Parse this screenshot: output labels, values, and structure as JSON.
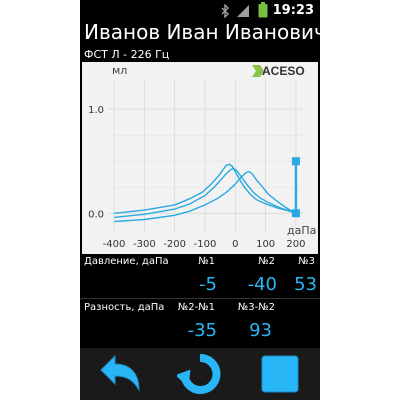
{
  "status_bar": {
    "time": "19:23",
    "icons": [
      "bluetooth-icon",
      "signal-icon",
      "battery-icon"
    ],
    "battery_color": "#76c043"
  },
  "header": {
    "patient_name": "Иванов Иван Иванович",
    "test_info": "ФСТ Л - 226 Гц",
    "brand_logo": "ACESO"
  },
  "chart_data": {
    "type": "line",
    "ylabel": "мл",
    "xlabel": "даПа",
    "x_ticks": [
      -400,
      -300,
      -200,
      -100,
      0,
      100,
      200
    ],
    "y_ticks": [
      "0.0",
      "1.0"
    ],
    "xlim": [
      -420,
      220
    ],
    "ylim": [
      -0.18,
      1.28
    ],
    "grid": true,
    "series": [
      {
        "x": [
          -400,
          -300,
          -200,
          -150,
          -110,
          -80,
          -55,
          -40,
          -30,
          -20,
          -10,
          0,
          15,
          30,
          50,
          70,
          100,
          140,
          180,
          200
        ],
        "y": [
          0.0,
          0.03,
          0.08,
          0.14,
          0.2,
          0.28,
          0.36,
          0.42,
          0.46,
          0.47,
          0.45,
          0.4,
          0.32,
          0.25,
          0.18,
          0.13,
          0.09,
          0.05,
          0.02,
          0.0
        ]
      },
      {
        "x": [
          -400,
          -300,
          -200,
          -150,
          -100,
          -70,
          -45,
          -30,
          -15,
          -5,
          5,
          20,
          40,
          60,
          80,
          110,
          150,
          180,
          200
        ],
        "y": [
          -0.04,
          -0.01,
          0.04,
          0.09,
          0.17,
          0.25,
          0.33,
          0.38,
          0.42,
          0.43,
          0.41,
          0.35,
          0.27,
          0.2,
          0.15,
          0.1,
          0.05,
          0.02,
          0.0
        ]
      },
      {
        "x": [
          -400,
          -300,
          -200,
          -150,
          -100,
          -60,
          -30,
          0,
          20,
          35,
          45,
          55,
          70,
          90,
          110,
          140,
          170,
          200
        ],
        "y": [
          -0.08,
          -0.06,
          -0.02,
          0.02,
          0.08,
          0.14,
          0.2,
          0.28,
          0.35,
          0.39,
          0.4,
          0.38,
          0.32,
          0.25,
          0.18,
          0.11,
          0.05,
          0.0
        ]
      }
    ],
    "marker": {
      "x": 200,
      "y_top": 0.5,
      "y_bottom": 0.0
    }
  },
  "readouts": {
    "pressure_label": "Давление, даПа",
    "diff_label": "Разность, даПа",
    "pressure_headers": [
      "№1",
      "№2",
      "№3"
    ],
    "pressure_values": [
      "-5",
      "-40",
      "53"
    ],
    "diff_headers": [
      "№2-№1",
      "№3-№2"
    ],
    "diff_values": [
      "-35",
      "93"
    ]
  },
  "toolbar": {
    "buttons": [
      "back-icon",
      "refresh-icon",
      "stop-icon"
    ],
    "accent": "#29b6f6"
  }
}
